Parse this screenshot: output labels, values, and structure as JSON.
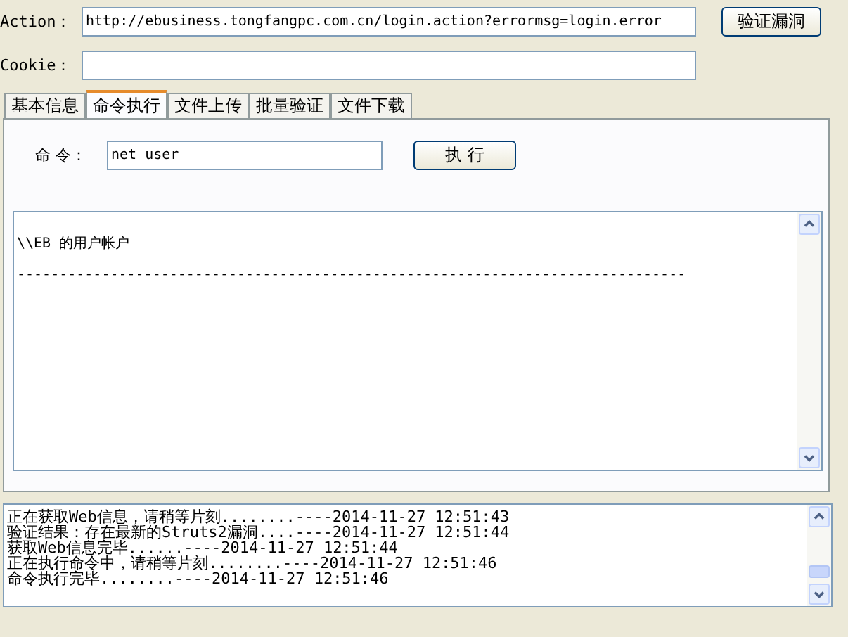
{
  "action": {
    "label": "Action：",
    "value": "http://ebusiness.tongfangpc.com.cn/login.action?errormsg=login.error"
  },
  "verify_button": "验证漏洞",
  "cookie": {
    "label": "Cookie："
  },
  "tabs": [
    {
      "label": "基本信息",
      "selected": false
    },
    {
      "label": "命令执行",
      "selected": true
    },
    {
      "label": "文件上传",
      "selected": false
    },
    {
      "label": "批量验证",
      "selected": false
    },
    {
      "label": "文件下载",
      "selected": false
    }
  ],
  "command": {
    "label": "命 令：",
    "value": "net user",
    "button": "执 行"
  },
  "output": [
    "\\\\EB 的用户帐户",
    "-------------------------------------------------------------------------------"
  ],
  "log": [
    "正在获取Web信息，请稍等片刻........----2014-11-27 12:51:43",
    "验证结果：存在最新的Struts2漏洞....----2014-11-27 12:51:44",
    "获取Web信息完毕......----2014-11-27 12:51:44",
    "正在执行命令中，请稍等片刻........----2014-11-27 12:51:46",
    "命令执行完毕........----2014-11-27 12:51:46"
  ]
}
